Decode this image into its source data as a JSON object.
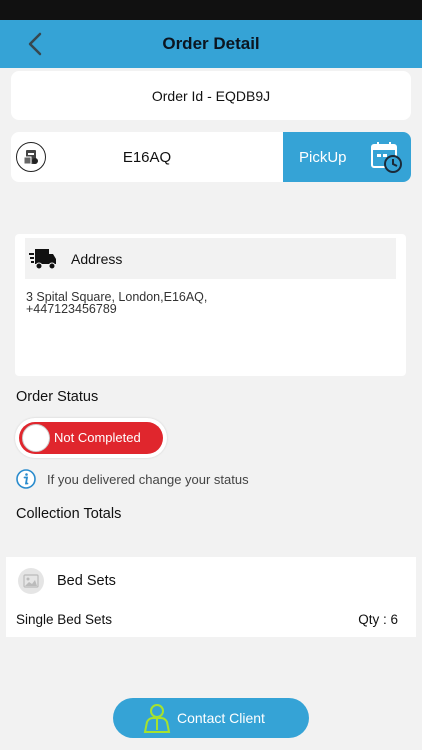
{
  "header": {
    "title": "Order Detail",
    "back_icon": "chevron-left-icon"
  },
  "order": {
    "id_label": "Order Id - EQDB9J"
  },
  "postcode_card": {
    "code": "E16AQ",
    "action_label": "PickUp",
    "left_icon": "parcel-icon",
    "right_icon": "calendar-clock-icon"
  },
  "address": {
    "label": "Address",
    "icon": "truck-icon",
    "line1": "3 Spital Square, London,E16AQ,",
    "line2": "+447123456789"
  },
  "status": {
    "section_label": "Order Status",
    "toggle_label": "Not Completed",
    "toggle_on": false,
    "info_icon": "info-icon",
    "info_text": "If you delivered change your status"
  },
  "collection": {
    "section_label": "Collection Totals",
    "group_name": "Bed Sets",
    "group_icon": "image-placeholder-icon",
    "items": [
      {
        "name": "Single Bed Sets",
        "qty_label": "Qty : 6"
      }
    ]
  },
  "contact": {
    "label": "Contact Client",
    "icon": "person-icon"
  },
  "colors": {
    "primary": "#35a3d6",
    "danger": "#e0262d",
    "background": "#f2f2f2"
  }
}
